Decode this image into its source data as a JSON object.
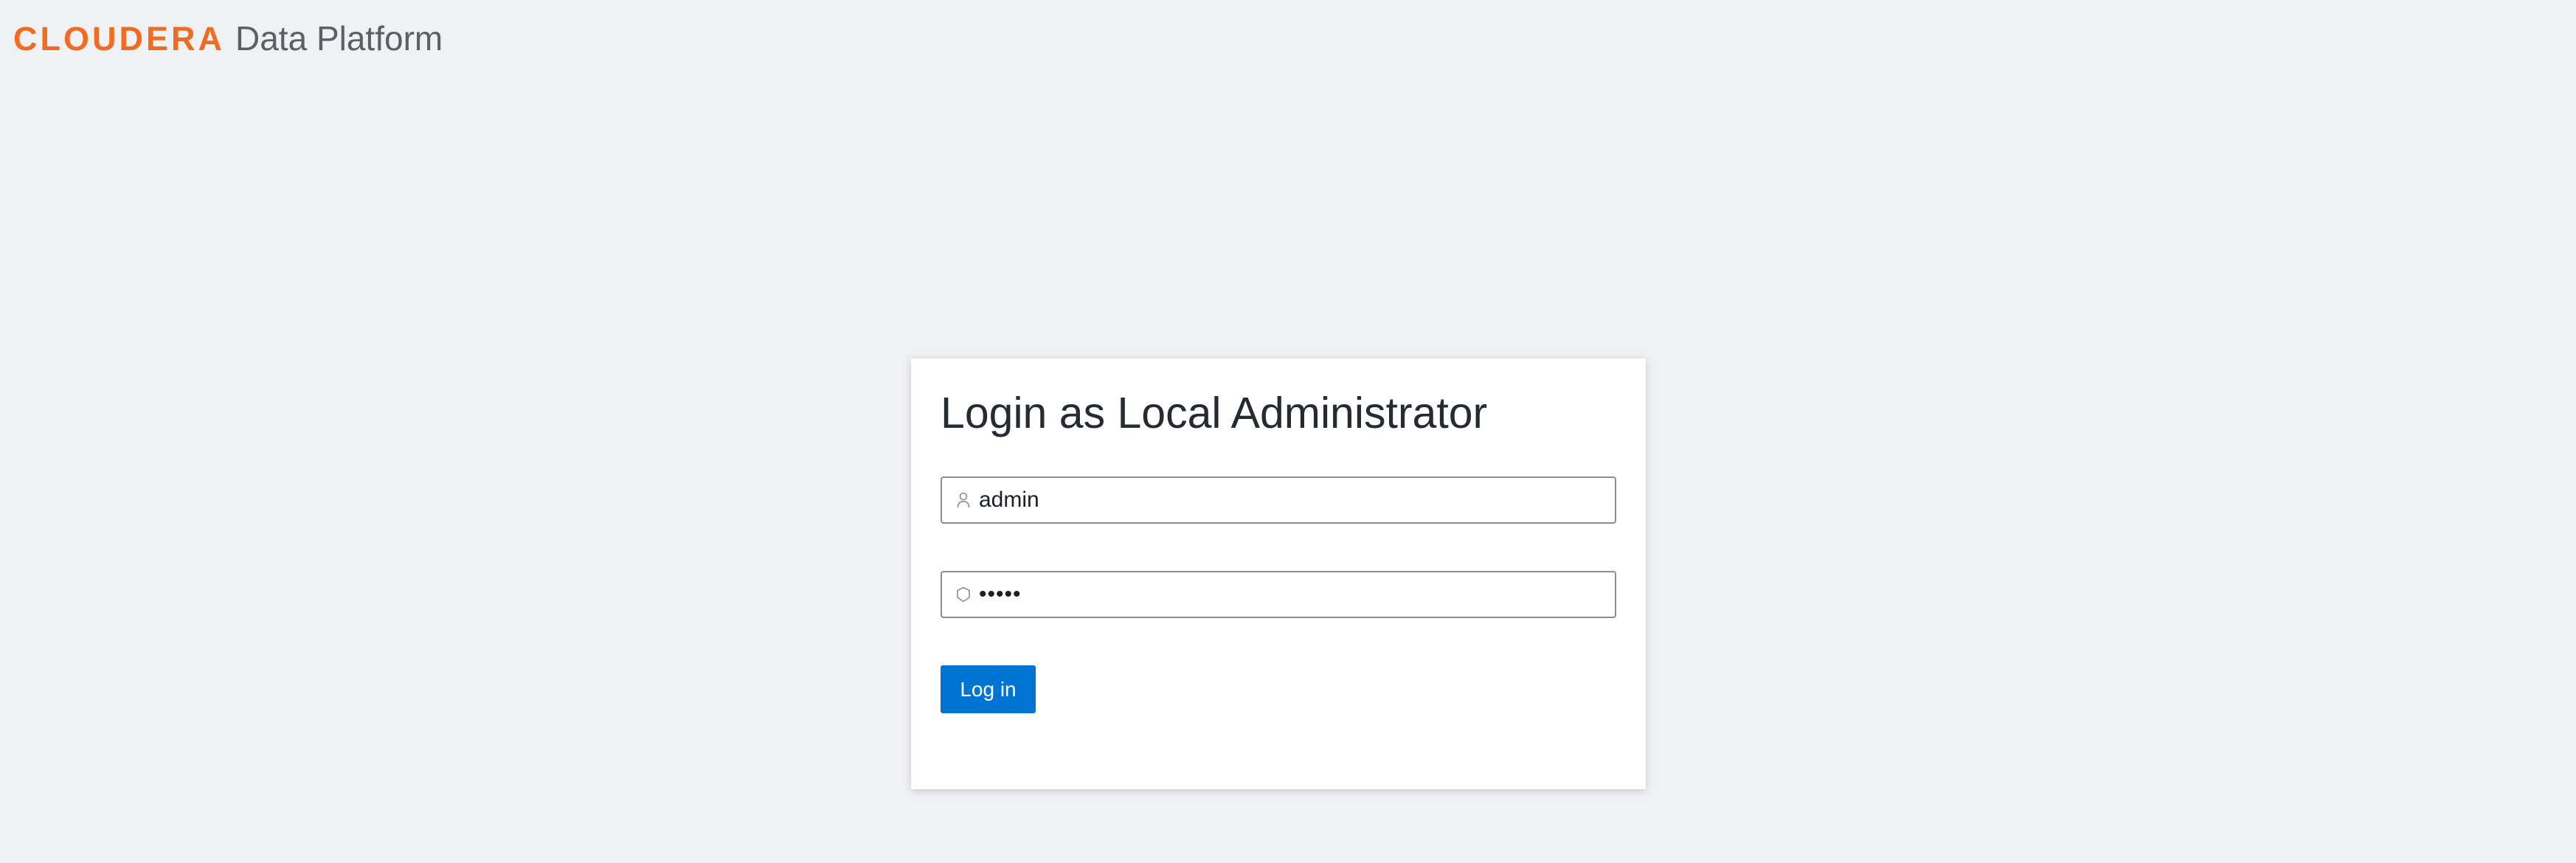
{
  "header": {
    "logo_text": "CLOUDERA",
    "product_name": "Data Platform",
    "logo_color": "#f26b21"
  },
  "login": {
    "title": "Login as Local Administrator",
    "username": {
      "value": "admin",
      "icon": "user-icon"
    },
    "password": {
      "value": "•••••",
      "icon": "shield-icon"
    },
    "submit_label": "Log in",
    "accent_color": "#0074d2"
  }
}
